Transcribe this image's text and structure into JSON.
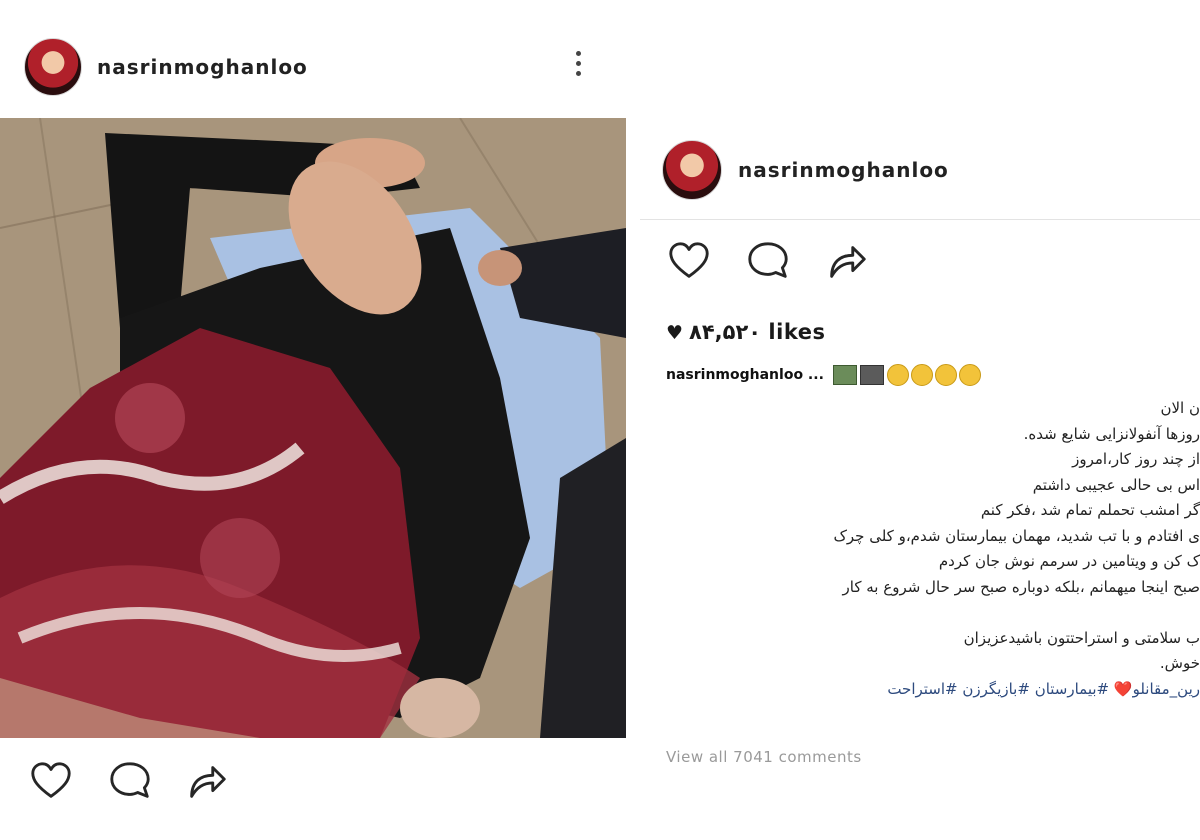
{
  "left_post": {
    "username": "nasrinmoghanloo",
    "more_icon": "more-vertical-icon",
    "actions": [
      "heart-icon",
      "comment-icon",
      "share-icon"
    ]
  },
  "right_post": {
    "username": "nasrinmoghanloo",
    "actions": [
      "heart-icon",
      "comment-icon",
      "share-icon"
    ],
    "likes_heart": "♥",
    "likes": "۸۴,۵۲۰ likes",
    "caption_user": "nasrinmoghanloo ...",
    "caption_lines": [
      "ن الان",
      "روزها آنفولانزایی شایع شده.",
      "از چند روز کار،امروز",
      "اس بی حالی عجیبی داشتم",
      "گر امشب تحملم تمام شد ،فکر کنم",
      "ی افتادم و با تب شدید، مهمان بیمارستان شدم،و کلی چرک",
      "ک کن و ویتامین در سرمم نوش جان کردم",
      "صبح اینجا میهمانم ،بلکه دوباره صبح سر حال شروع به کار",
      "",
      "ب سلامتی و استراحتتون باشیدعزیزان",
      "خوش."
    ],
    "hashtags": "رین_مقانلو❤️ #بیمارستان #بازیگرزن #استراحت",
    "view_all": "View all 7041 comments"
  },
  "colors": {
    "text": "#262626",
    "hashtag": "#2d4a7e",
    "muted": "#9a9a9a",
    "divider": "#e3e3e3"
  }
}
